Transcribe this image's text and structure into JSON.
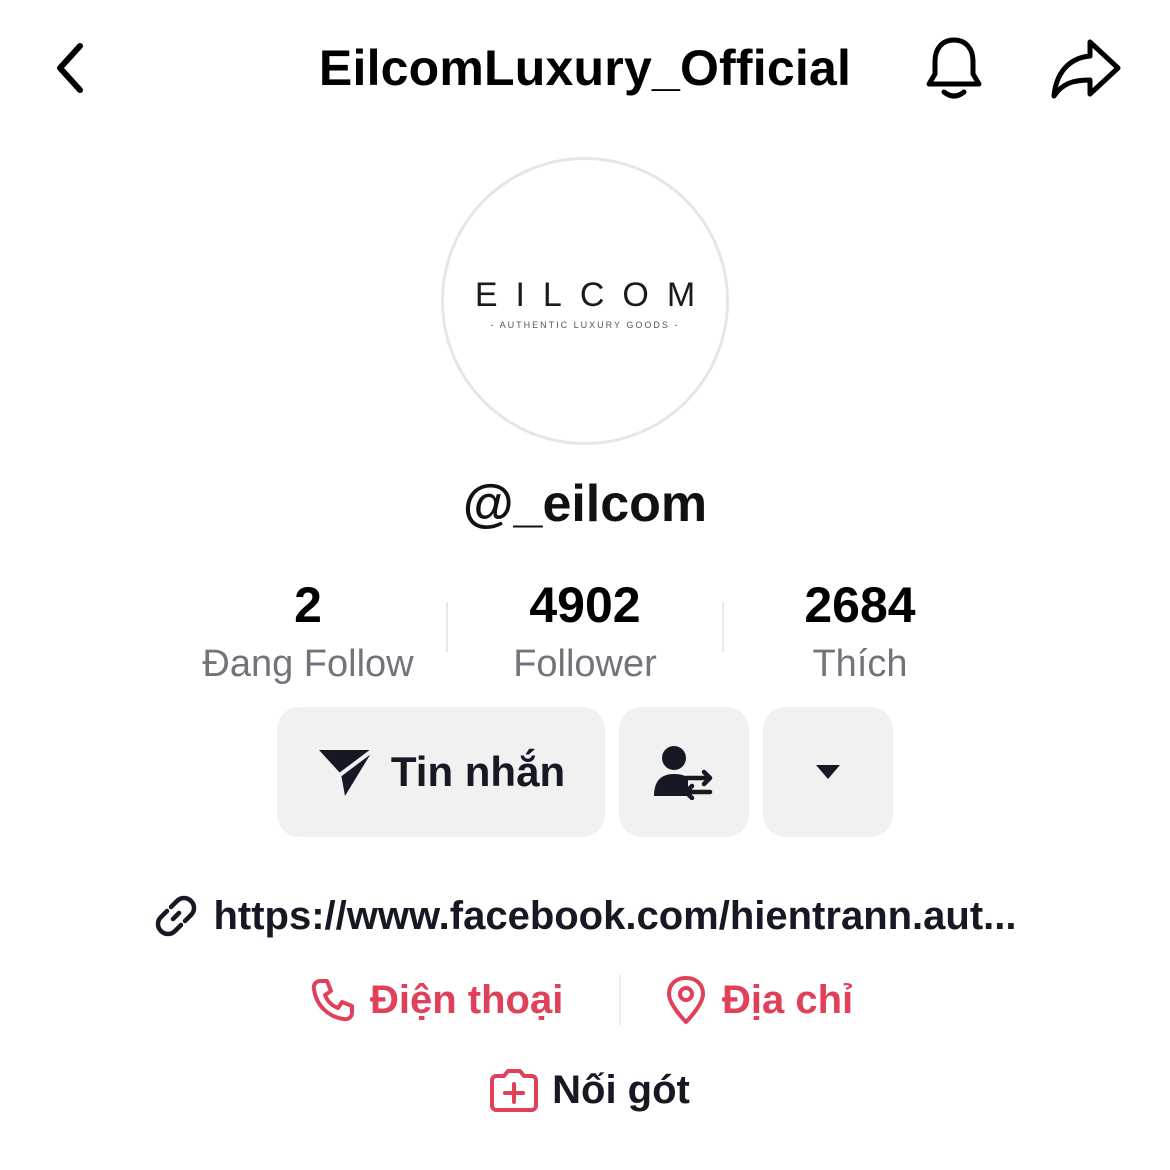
{
  "header": {
    "title": "EilcomLuxury_Official",
    "back_icon": "chevron-left-icon",
    "bell_icon": "bell-icon",
    "share_icon": "share-arrow-icon"
  },
  "avatar": {
    "logo_word": "EILCOM",
    "logo_tagline": "- AUTHENTIC LUXURY GOODS -"
  },
  "profile": {
    "username": "@_eilcom"
  },
  "stats": [
    {
      "value": "2",
      "label": "Đang Follow"
    },
    {
      "value": "4902",
      "label": "Follower"
    },
    {
      "value": "2684",
      "label": "Thích"
    }
  ],
  "actions": {
    "message_label": "Tin nhắn",
    "message_icon": "paper-plane-icon",
    "friend_icon": "person-swap-icon",
    "dropdown_icon": "caret-down-icon"
  },
  "bio": {
    "link": "https://www.facebook.com/hientrann.aut...",
    "link_icon": "link-icon"
  },
  "contact": {
    "phone_label": "Điện thoại",
    "address_label": "Địa chỉ",
    "accent_color": "#e0405a"
  },
  "connect": {
    "label": "Nối gót",
    "icon": "add-post-icon"
  }
}
